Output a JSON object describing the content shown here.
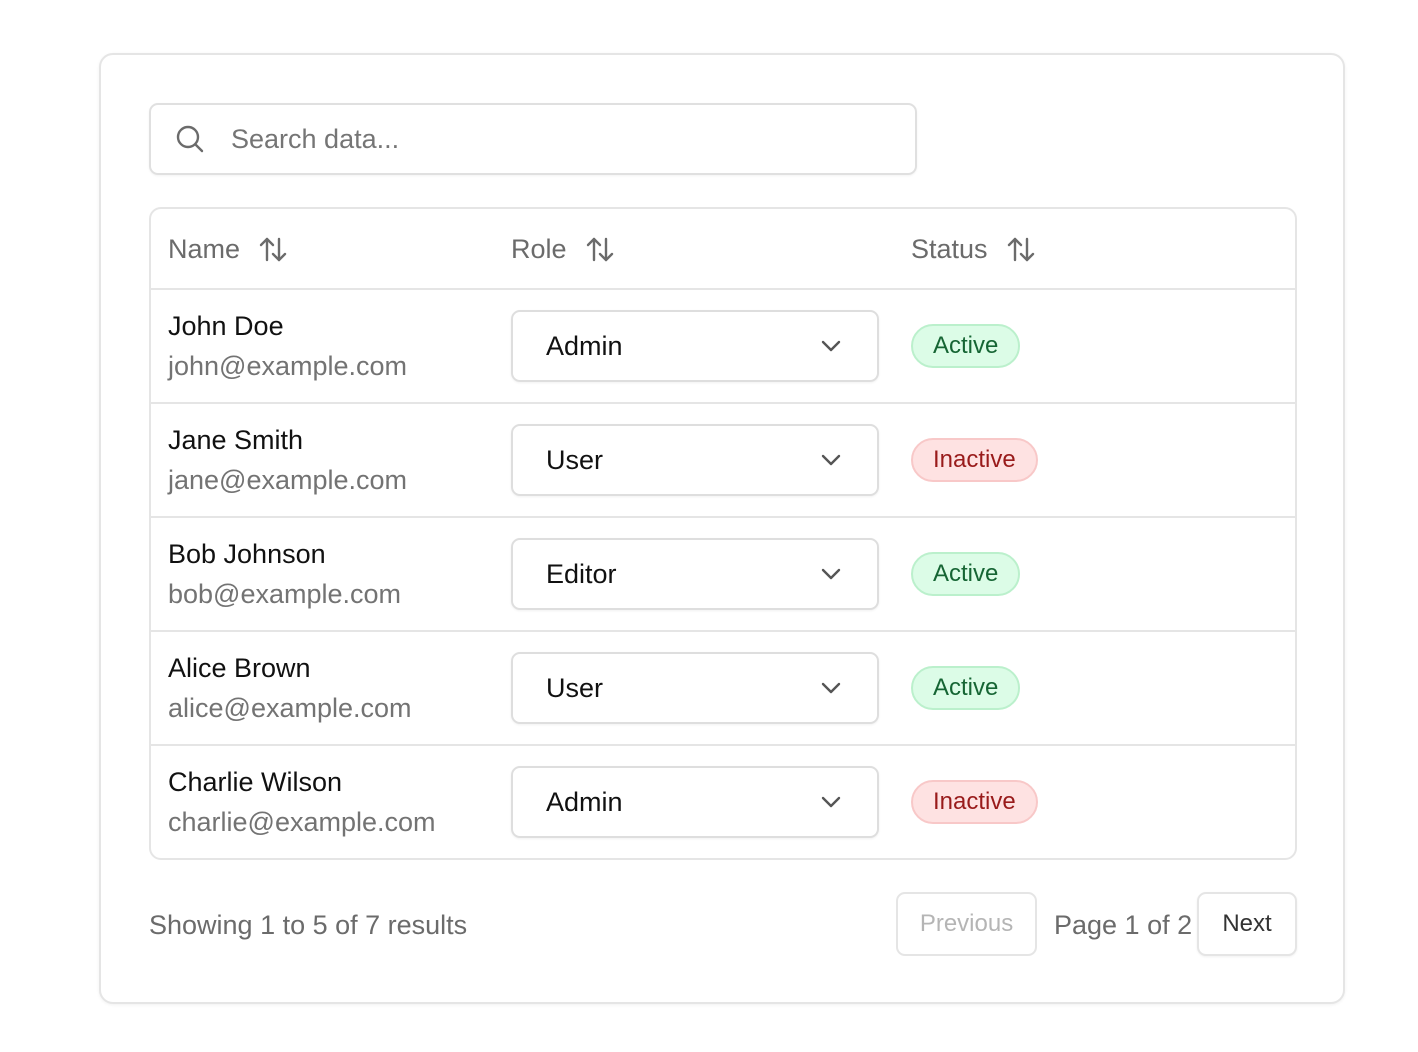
{
  "search": {
    "placeholder": "Search data..."
  },
  "columns": {
    "name": "Name",
    "role": "Role",
    "status": "Status"
  },
  "rows": [
    {
      "name": "John Doe",
      "email": "john@example.com",
      "role": "Admin",
      "status": "Active"
    },
    {
      "name": "Jane Smith",
      "email": "jane@example.com",
      "role": "User",
      "status": "Inactive"
    },
    {
      "name": "Bob Johnson",
      "email": "bob@example.com",
      "role": "Editor",
      "status": "Active"
    },
    {
      "name": "Alice Brown",
      "email": "alice@example.com",
      "role": "User",
      "status": "Active"
    },
    {
      "name": "Charlie Wilson",
      "email": "charlie@example.com",
      "role": "Admin",
      "status": "Inactive"
    }
  ],
  "footer": {
    "summary": "Showing 1 to 5 of 7 results",
    "previous": "Previous",
    "page": "Page 1 of 2",
    "next": "Next"
  },
  "colors": {
    "active_bg": "#dcfce7",
    "active_text": "#166534",
    "inactive_bg": "#fee2e2",
    "inactive_text": "#991b1b",
    "border": "#e5e5e5"
  },
  "icons": {
    "search": "search-icon",
    "sort": "sort-arrows-icon",
    "dropdown": "chevron-down-icon"
  }
}
